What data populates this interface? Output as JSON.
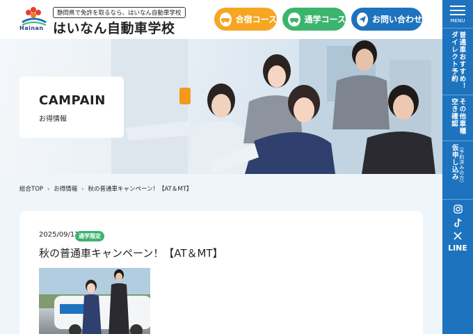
{
  "header": {
    "logo_text": "Hainan",
    "tagline": "静岡県で免許を取るなら、はいなん自動車学校",
    "school_name": "はいなん自動車学校",
    "buttons": [
      {
        "label": "合宿コース"
      },
      {
        "label": "通学コース"
      },
      {
        "label": "お問い合わせ"
      }
    ]
  },
  "sidebar": {
    "menu_label": "MENU",
    "items": [
      {
        "label": "普通車おすすめ！ダイレクト予約"
      },
      {
        "label": "その他車種空き確認"
      },
      {
        "label": "仮申し込み",
        "note": "（予約済みの方）"
      }
    ],
    "line_label": "LINE"
  },
  "hero": {
    "title": "CAMPAIN",
    "subtitle": "お得情報"
  },
  "breadcrumb": {
    "items": [
      "総合TOP",
      "お得情報",
      "秋の普通車キャンペーン！【AT＆MT】"
    ]
  },
  "post": {
    "date": "2025/09/17",
    "badge": "通学限定",
    "title": "秋の普通車キャンペーン！【AT＆MT】"
  },
  "colors": {
    "primary_blue": "#1e73be",
    "green": "#3cb46e",
    "orange": "#f5a623"
  }
}
